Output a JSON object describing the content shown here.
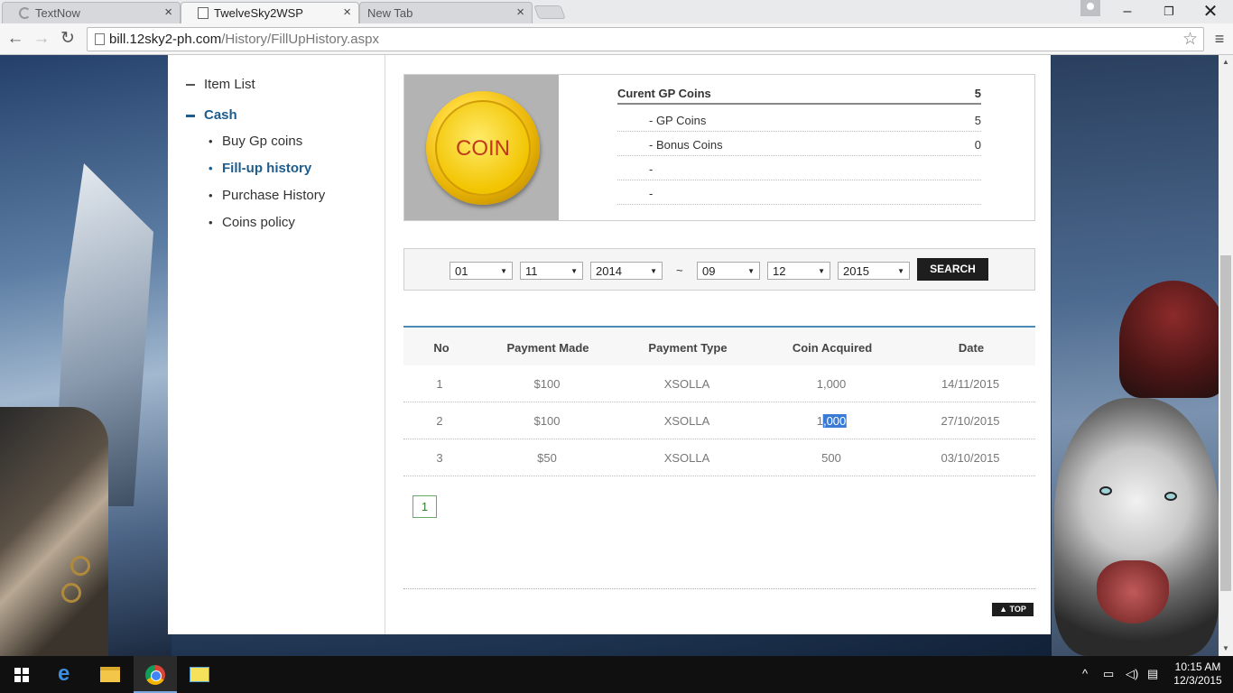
{
  "browser": {
    "tabs": [
      {
        "label": "TextNow",
        "active": false
      },
      {
        "label": "TwelveSky2WSP",
        "active": true
      },
      {
        "label": "New Tab",
        "active": false
      }
    ],
    "url_domain": "bill.12sky2-ph.com",
    "url_path": "/History/FillUpHistory.aspx"
  },
  "sidebar": {
    "top_items": [
      {
        "label": "Item List",
        "active": false
      },
      {
        "label": "Cash",
        "active": true
      }
    ],
    "sub_items": [
      {
        "label": "Buy Gp coins",
        "active": false
      },
      {
        "label": "Fill-up history",
        "active": true
      },
      {
        "label": "Purchase History",
        "active": false
      },
      {
        "label": "Coins policy",
        "active": false
      }
    ]
  },
  "coins": {
    "image_text": "COIN",
    "current_label": "Curent GP Coins",
    "current_value": "5",
    "rows": [
      {
        "label": "- GP Coins",
        "value": "5"
      },
      {
        "label": "- Bonus Coins",
        "value": "0"
      },
      {
        "label": "-",
        "value": ""
      },
      {
        "label": "-",
        "value": ""
      }
    ]
  },
  "search": {
    "from_month": "01",
    "from_day": "11",
    "from_year": "2014",
    "separator": "~",
    "to_month": "09",
    "to_day": "12",
    "to_year": "2015",
    "button_label": "SEARCH"
  },
  "history": {
    "columns": [
      "No",
      "Payment Made",
      "Payment Type",
      "Coin Acquired",
      "Date"
    ],
    "rows": [
      {
        "no": "1",
        "payment": "$100",
        "type": "XSOLLA",
        "coin": "1,000",
        "date": "14/11/2015"
      },
      {
        "no": "2",
        "payment": "$100",
        "type": "XSOLLA",
        "coin_pre": "1",
        "coin_sel": ",000",
        "date": "27/10/2015"
      },
      {
        "no": "3",
        "payment": "$50",
        "type": "XSOLLA",
        "coin": "500",
        "date": "03/10/2015"
      }
    ],
    "page": "1"
  },
  "footer": {
    "top_label": "▲ TOP"
  },
  "taskbar": {
    "time": "10:15 AM",
    "date": "12/3/2015"
  },
  "colors": {
    "nav_active": "#1d5c8c",
    "table_rule": "#4a8ab3",
    "button_bg": "#1e1e1e"
  }
}
